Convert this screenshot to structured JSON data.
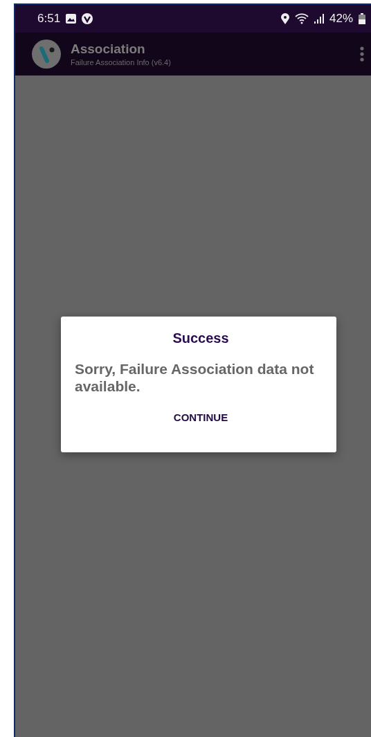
{
  "status_bar": {
    "time": "6:51",
    "battery": "42%"
  },
  "app_bar": {
    "title": "Association",
    "subtitle": "Failure Association Info (v6.4)"
  },
  "dialog": {
    "title": "Success",
    "message": "Sorry, Failure Association data not available.",
    "button": "CONTINUE"
  }
}
